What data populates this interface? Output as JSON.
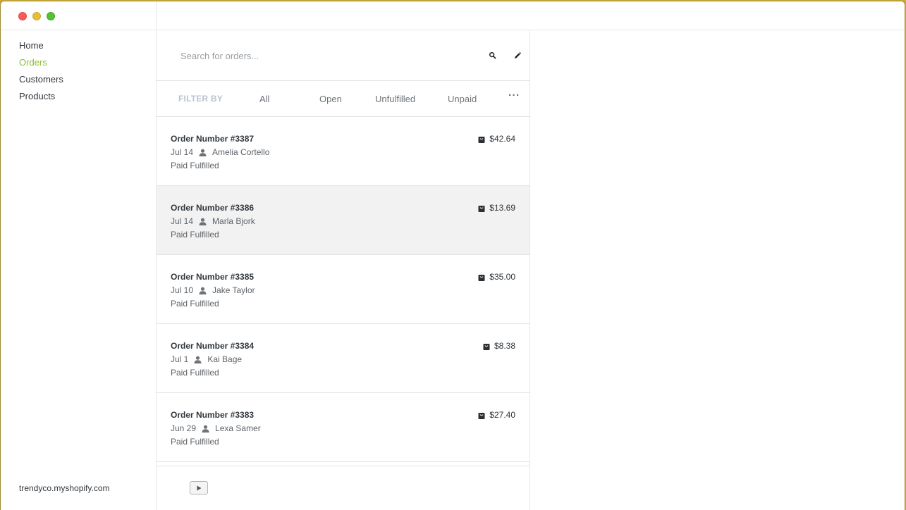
{
  "sidebar": {
    "items": [
      {
        "label": "Home",
        "active": false
      },
      {
        "label": "Orders",
        "active": true
      },
      {
        "label": "Customers",
        "active": false
      },
      {
        "label": "Products",
        "active": false
      }
    ],
    "store": "trendyco.myshopify.com"
  },
  "search": {
    "placeholder": "Search for orders...",
    "icon": "search-icon",
    "edit_icon": "pencil-icon"
  },
  "filters": {
    "label": "FILTER BY",
    "options": [
      "All",
      "Open",
      "Unfulfilled",
      "Unpaid"
    ],
    "more": "···"
  },
  "orders": [
    {
      "title": "Order Number #3387",
      "date": "Jul 14",
      "customer": "Amelia Cortello",
      "status": "Paid Fulfilled",
      "total": "$42.64",
      "selected": false
    },
    {
      "title": "Order Number #3386",
      "date": "Jul 14",
      "customer": "Marla Bjork",
      "status": "Paid Fulfilled",
      "total": "$13.69",
      "selected": true
    },
    {
      "title": "Order Number #3385",
      "date": "Jul 10",
      "customer": "Jake Taylor",
      "status": "Paid Fulfilled",
      "total": "$35.00",
      "selected": false
    },
    {
      "title": "Order Number #3384",
      "date": "Jul 1",
      "customer": "Kai Bage",
      "status": "Paid Fulfilled",
      "total": "$8.38",
      "selected": false
    },
    {
      "title": "Order Number #3383",
      "date": "Jun 29",
      "customer": "Lexa Samer",
      "status": "Paid Fulfilled",
      "total": "$27.40",
      "selected": false
    }
  ],
  "colors": {
    "accent": "#8dbd3a",
    "text": "#31373d",
    "selected_row": "#f2f2f2"
  }
}
